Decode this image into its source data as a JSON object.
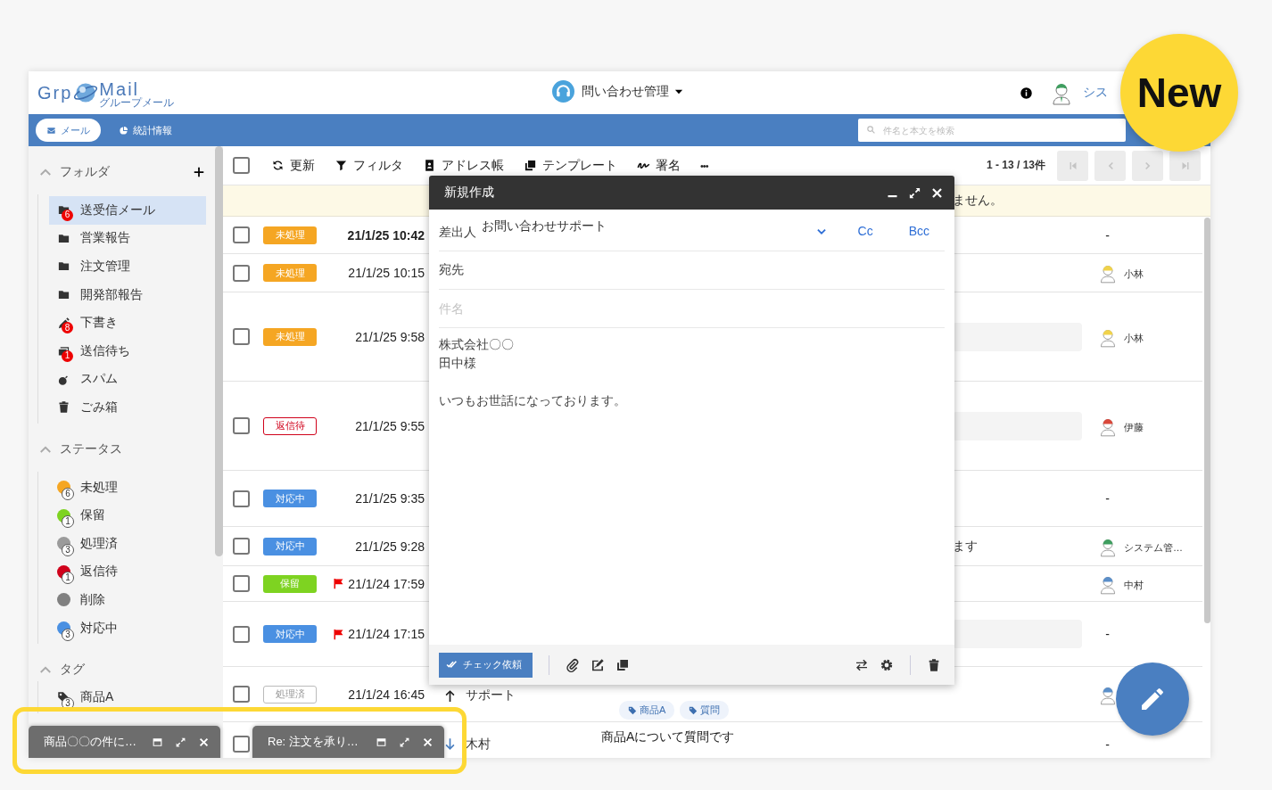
{
  "header": {
    "logo_left": "Grp",
    "logo_right": "Mail",
    "logo_sub": "グループメール",
    "title": "問い合わせ管理",
    "user_name": "シス"
  },
  "nav": {
    "tabs": [
      {
        "label": "メール",
        "kind": "mail",
        "selected": true
      },
      {
        "label": "統計情報",
        "kind": "stats",
        "selected": false
      }
    ],
    "search": {
      "placeholder": "件名と本文を検索"
    }
  },
  "sidebar": {
    "sections": [
      {
        "title": "フォルダ",
        "kind": "folder",
        "expanded": true,
        "add": true,
        "items": [
          {
            "label": "送受信メール",
            "kind": "folder",
            "selected": true,
            "badge": "6"
          },
          {
            "label": "営業報告",
            "kind": "folder",
            "selected": false
          },
          {
            "label": "注文管理",
            "kind": "folder",
            "selected": false
          },
          {
            "label": "開発部報告",
            "kind": "folder",
            "selected": false
          },
          {
            "label": "下書き",
            "kind": "draft",
            "selected": false,
            "badge": "8"
          },
          {
            "label": "送信待ち",
            "kind": "outbox",
            "selected": false,
            "badge": "1"
          },
          {
            "label": "スパム",
            "kind": "spam",
            "selected": false
          },
          {
            "label": "ごみ箱",
            "kind": "trash",
            "selected": false
          }
        ]
      },
      {
        "title": "ステータス",
        "kind": "status",
        "expanded": true,
        "add": false,
        "items": [
          {
            "label": "未処理",
            "kind": "status",
            "color": "#f5a623",
            "count": "6",
            "selected": false
          },
          {
            "label": "保留",
            "kind": "status",
            "color": "#7ed321",
            "count": "1",
            "selected": false
          },
          {
            "label": "処理済",
            "kind": "status",
            "color": "#9b9b9b",
            "count": "3",
            "selected": false
          },
          {
            "label": "返信待",
            "kind": "status",
            "color": "#d0021b",
            "count": "1",
            "selected": false
          },
          {
            "label": "削除",
            "kind": "status",
            "color": "#808080",
            "selected": false
          },
          {
            "label": "対応中",
            "kind": "status",
            "color": "#4a90e2",
            "count": "3",
            "selected": false
          }
        ]
      },
      {
        "title": "タグ",
        "kind": "tag",
        "expanded": true,
        "add": false,
        "items": [
          {
            "label": "商品A",
            "kind": "tag",
            "count": "3",
            "selected": false
          }
        ]
      }
    ]
  },
  "toolbar": {
    "select_all": {
      "checked": false
    },
    "buttons": [
      {
        "label": "更新",
        "kind": "refresh"
      },
      {
        "label": "フィルタ",
        "kind": "filter"
      },
      {
        "label": "アドレス帳",
        "kind": "address"
      },
      {
        "label": "テンプレート",
        "kind": "template"
      },
      {
        "label": "署名",
        "kind": "signature"
      },
      {
        "label": "•••",
        "kind": "more"
      }
    ],
    "count": "1 - 13 / 13件",
    "pager": [
      {
        "kind": "first",
        "disabled": true
      },
      {
        "kind": "prev",
        "disabled": true
      },
      {
        "kind": "next",
        "disabled": true
      },
      {
        "kind": "last",
        "disabled": true
      }
    ]
  },
  "notice": "ません。",
  "rows": [
    {
      "checked": false,
      "status": {
        "label": "未処理",
        "kind": "todo"
      },
      "flagged": false,
      "unread": true,
      "date": "21/1/25 10:42",
      "assignee": {
        "kind": "none",
        "name": "-"
      }
    },
    {
      "checked": false,
      "status": {
        "label": "未処理",
        "kind": "todo"
      },
      "flagged": false,
      "unread": false,
      "date": "21/1/25 10:15",
      "assignee": {
        "kind": "person",
        "name": "小林",
        "color": "#f0d24a"
      }
    },
    {
      "checked": false,
      "status": {
        "label": "未処理",
        "kind": "todo"
      },
      "flagged": false,
      "unread": false,
      "date": "21/1/25 9:58",
      "preview": true,
      "assignee": {
        "kind": "person",
        "name": "小林",
        "color": "#f0d24a"
      }
    },
    {
      "checked": false,
      "status": {
        "label": "返信待",
        "kind": "wait"
      },
      "flagged": false,
      "unread": false,
      "date": "21/1/25 9:55",
      "preview": true,
      "assignee": {
        "kind": "person",
        "name": "伊藤",
        "color": "#d9483b"
      }
    },
    {
      "checked": false,
      "status": {
        "label": "対応中",
        "kind": "active"
      },
      "flagged": false,
      "unread": false,
      "date": "21/1/25 9:35",
      "assignee": {
        "kind": "none",
        "name": "-"
      }
    },
    {
      "checked": false,
      "status": {
        "label": "対応中",
        "kind": "active"
      },
      "flagged": false,
      "unread": false,
      "date": "21/1/25 9:28",
      "snippet": "ます",
      "assignee": {
        "kind": "person",
        "name": "システム管…",
        "color": "#3f9e5f"
      }
    },
    {
      "checked": false,
      "status": {
        "label": "保留",
        "kind": "hold"
      },
      "flagged": true,
      "unread": false,
      "date": "21/1/24 17:59",
      "assignee": {
        "kind": "person",
        "name": "中村",
        "color": "#5b8fc9"
      }
    },
    {
      "checked": false,
      "status": {
        "label": "対応中",
        "kind": "active"
      },
      "flagged": true,
      "unread": false,
      "date": "21/1/24 17:15",
      "preview": true,
      "assignee": {
        "kind": "none",
        "name": "-"
      }
    },
    {
      "checked": false,
      "status": {
        "label": "処理済",
        "kind": "done"
      },
      "flagged": false,
      "unread": false,
      "date": "21/1/24 16:45",
      "arrow": {
        "kind": "sent"
      },
      "sender": "サポート",
      "tags": [
        "商品A",
        "質問"
      ],
      "assignee": {
        "kind": "person",
        "color": "#5b8fc9"
      }
    },
    {
      "checked": false,
      "arrow": {
        "kind": "received"
      },
      "sender": "木村",
      "subject": "商品Aについて質問です",
      "assignee": {
        "kind": "none",
        "name": "-"
      }
    }
  ],
  "compose": {
    "title": "新規作成",
    "from_label": "差出人",
    "from": "お問い合わせサポート",
    "cc": "Cc",
    "bcc": "Bcc",
    "to_label": "宛先",
    "subject_placeholder": "件名",
    "body": [
      [
        "株式会社〇〇",
        "田中様"
      ],
      [
        "いつもお世話になっております。"
      ]
    ],
    "check_button": "チェック依頼"
  },
  "minimized": [
    {
      "title": "商品〇〇の件に…"
    },
    {
      "title": "Re: 注文を承り…"
    }
  ],
  "badge": {
    "label": "New"
  }
}
